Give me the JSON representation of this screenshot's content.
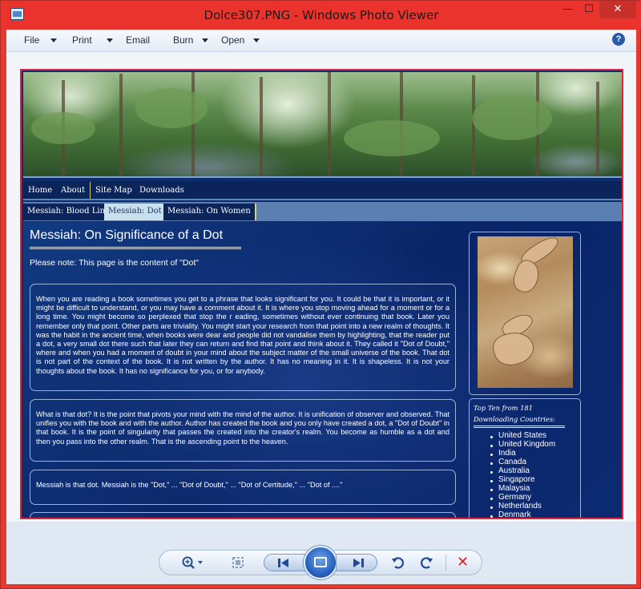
{
  "window": {
    "title": "Dolce307.PNG - Windows Photo Viewer",
    "minimize": "—",
    "maximize": "☐",
    "close": "✕"
  },
  "menu": {
    "file": "File",
    "print": "Print",
    "email": "Email",
    "burn": "Burn",
    "open": "Open",
    "help": "?"
  },
  "page": {
    "nav_primary": [
      "Home",
      "About",
      "Site Map",
      "Downloads"
    ],
    "nav_secondary": [
      "Messiah: Blood Line",
      "Messiah: Dot",
      "Messiah: On Women"
    ],
    "nav_secondary_active": "Messiah: Dot",
    "title": "Messiah: On Significance of a Dot",
    "note": "Please note: This page is the content of \"Dot\"",
    "paragraphs": [
      "When you are reading a book sometimes you get to a phrase that looks significant for you. It could be that it is important, or it might be difficult to understand, or you may have a comment about it. It is where you stop moving ahead for a moment or for a long time. You might become so perplexed that stop the r eading, sometimes without ever continuing that book. Later you remember only that point. Other parts are triviality. You might start your research from that point into a new realm of thoughts. It was the habit in the ancient time, when books were dear and people did not vandalise them by highlighting, that the reader put a dot, a very small dot there such that later they can return and find that point and think about it. They called it \"Dot of Doubt,\" where and when you had a moment of doubt in your mind about the subject matter of the small universe of the book. That dot is not part of the context of the book. It is not written by the author. It has no meaning in it. It is shapeless. It is not your thoughts about the book. It has no significance for you, or for anybody.",
      "What is that dot? It is the point that pivots your mind with the mind of the author. It is unification of observer and observed. That unifies you with the book and with the author. Author has created the book and you only have created a dot, a \"Dot of Doubt\" in that book. It is the point of singularity that passes the created into the creator's realm. You become as humble as a dot and then you pass into the other realm. That is the ascending point to the heaven.",
      "Messiah is that dot. Messiah is the \"Dot,\" ... \"Dot of Doubt,\" ... \"Dot of Certitude,\" ... \"Dot of ....\""
    ],
    "countries_title": "Top Ten from 181 Downloading Countries:",
    "countries": [
      "United States",
      "United Kingdom",
      "India",
      "Canada",
      "Australia",
      "Singapore",
      "Malaysia",
      "Germany",
      "Netherlands",
      "Denmark"
    ]
  },
  "toolbar": {
    "zoom_icon": "zoom-icon",
    "fit_icon": "actual-size-icon",
    "prev_icon": "previous-icon",
    "slideshow_icon": "slideshow-icon",
    "next_icon": "next-icon",
    "rotate_ccw_icon": "rotate-counterclockwise-icon",
    "rotate_cw_icon": "rotate-clockwise-icon",
    "delete_icon": "delete-icon"
  },
  "colors": {
    "title_bar": "#e9332c",
    "page_background": "#0a2568",
    "active_tab": "#c9e1ee",
    "delete_red": "#d2262b"
  }
}
